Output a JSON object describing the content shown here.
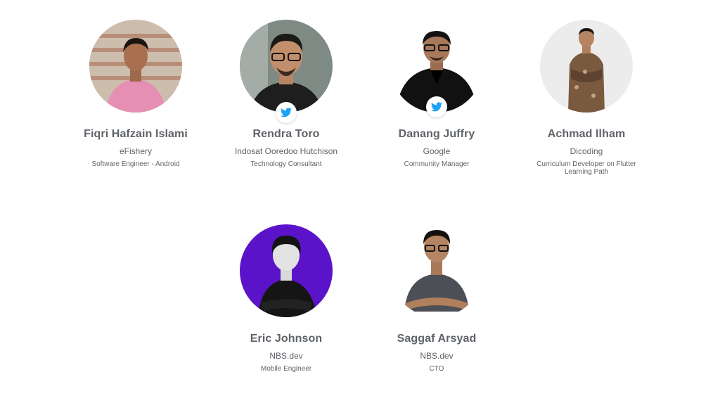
{
  "accent": "#1da1f2",
  "text_color": "#5f6368",
  "speakers": [
    {
      "name": "Fiqri Hafzain Islami",
      "company": "eFishery",
      "role": "Software Engineer - Android",
      "twitter": false,
      "avatar_bg": "#c9b7a6",
      "shirt_color": "#e58fb3"
    },
    {
      "name": "Rendra Toro",
      "company": "Indosat Ooredoo Hutchison",
      "role": "Technology Consultant",
      "twitter": true,
      "avatar_bg": "#7d8a84",
      "shirt_color": "#1e1e1e"
    },
    {
      "name": "Danang Juffry",
      "company": "Google",
      "role": "Community Manager",
      "twitter": true,
      "avatar_bg": "#ffffff",
      "shirt_color": "#111111"
    },
    {
      "name": "Achmad Ilham",
      "company": "Dicoding",
      "role": "Curriculum Developer on Flutter Learning Path",
      "twitter": false,
      "avatar_bg": "#e9e9e9",
      "shirt_color": "#7a5a3e"
    },
    {
      "name": "Eric Johnson",
      "company": "NBS.dev",
      "role": "Mobile Engineer",
      "twitter": false,
      "avatar_bg": "#5b13c9",
      "shirt_color": "#151515"
    },
    {
      "name": "Saggaf Arsyad",
      "company": "NBS.dev",
      "role": "CTO",
      "twitter": false,
      "avatar_bg": "#ffffff",
      "shirt_color": "#4c4f55"
    }
  ]
}
